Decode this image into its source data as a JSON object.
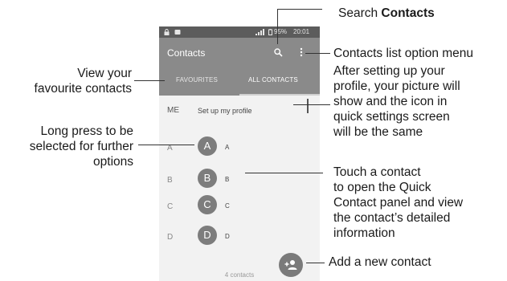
{
  "callouts": {
    "search": {
      "prefix": "Search ",
      "bold": "Contacts"
    },
    "option_menu": "Contacts list option menu",
    "profile_note": [
      "After setting up your",
      "profile, your picture will",
      "show and the icon in",
      "quick settings screen",
      "will be the same"
    ],
    "favourites": [
      "View your",
      "favourite contacts"
    ],
    "long_press": [
      "Long press to be",
      "selected for further",
      "options"
    ],
    "touch_contact": [
      "Touch a contact",
      "to open the Quick",
      "Contact panel and view",
      "the contact’s detailed",
      "information"
    ],
    "add_contact": "Add a new contact"
  },
  "phone": {
    "status": {
      "battery": "95%",
      "time": "20:01"
    },
    "app_title": "Contacts",
    "tabs": [
      "FAVOURITES",
      "ALL CONTACTS"
    ],
    "me": {
      "label": "ME",
      "text": "Set up my profile"
    },
    "contacts": [
      {
        "letter": "A",
        "initial": "A",
        "name": "A"
      },
      {
        "letter": "B",
        "initial": "B",
        "name": "B"
      },
      {
        "letter": "C",
        "initial": "C",
        "name": "C"
      },
      {
        "letter": "D",
        "initial": "D",
        "name": "D"
      }
    ],
    "count": "4 contacts"
  },
  "icons": {
    "search": "search-icon",
    "menu": "more-vert-icon",
    "add": "add-contact-icon",
    "lock": "lock-icon",
    "signal": "signal-icon"
  }
}
